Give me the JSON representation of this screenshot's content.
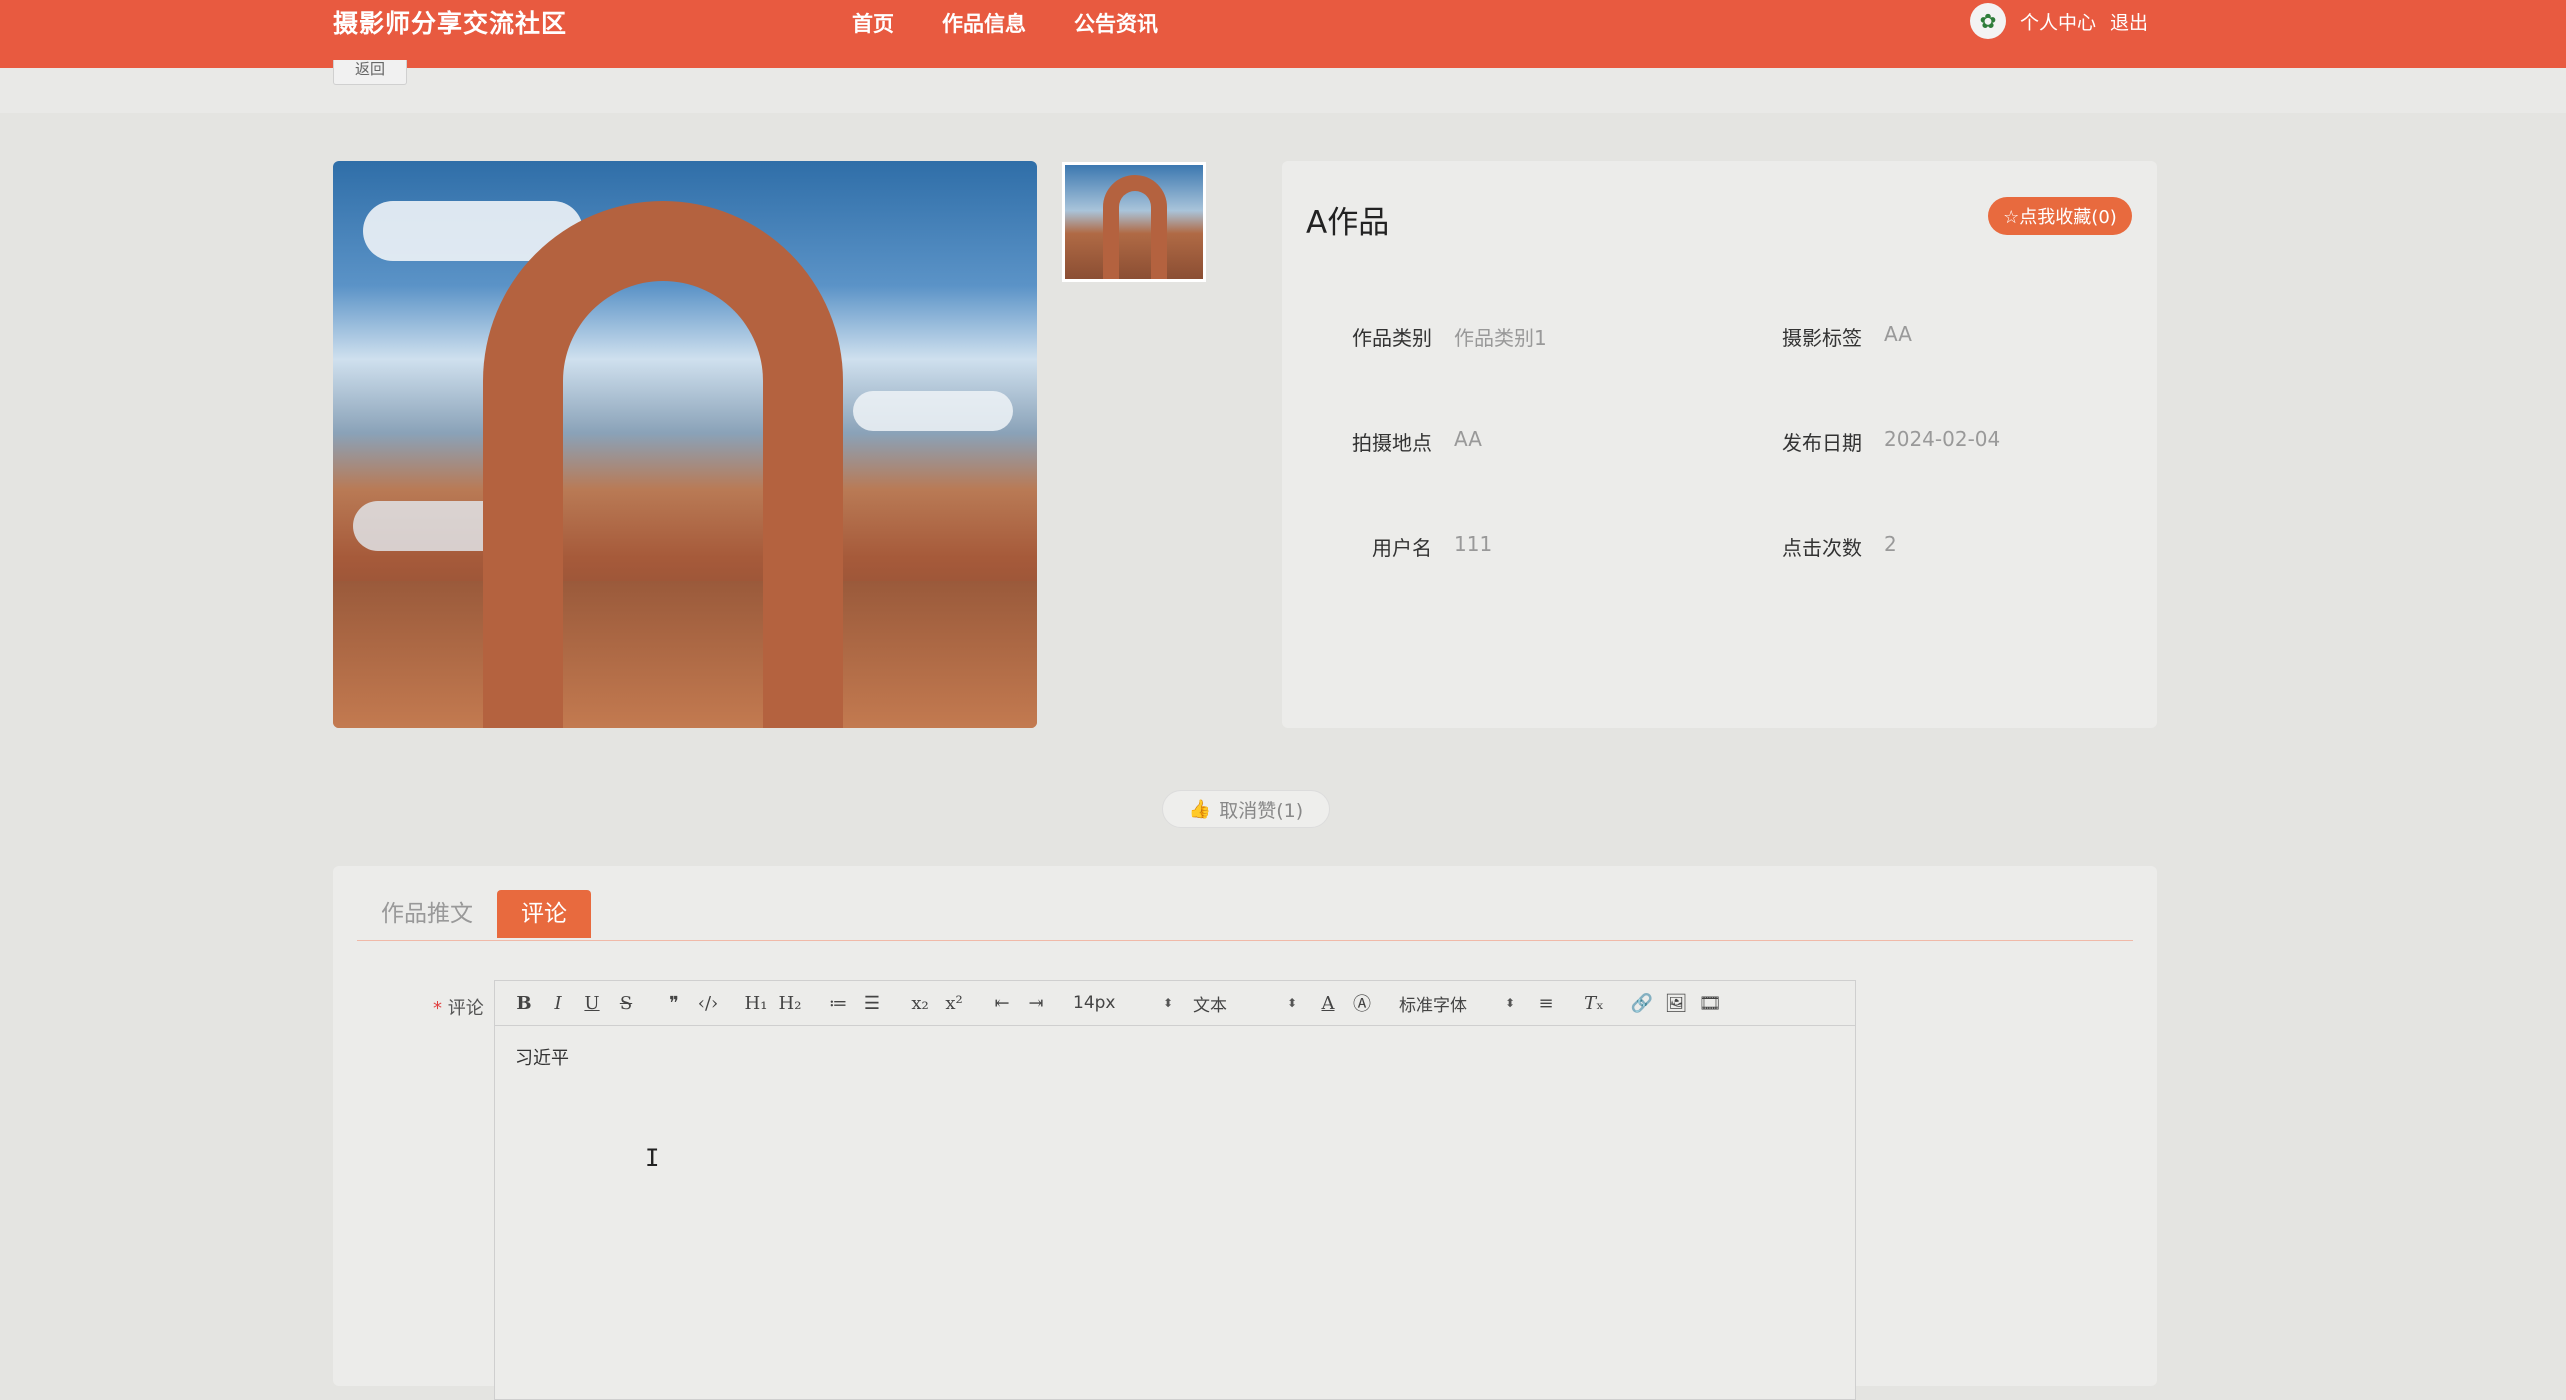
{
  "header": {
    "brand": "摄影师分享交流社区",
    "nav": [
      "首页",
      "作品信息",
      "公告资讯"
    ],
    "user_center": "个人中心",
    "logout": "退出"
  },
  "back_label": "返回",
  "work": {
    "title": "A作品",
    "favorite_label": "☆点我收藏(0)",
    "fields": [
      {
        "label": "作品类别",
        "value": "作品类别1"
      },
      {
        "label": "摄影标签",
        "value": "AA"
      },
      {
        "label": "拍摄地点",
        "value": "AA"
      },
      {
        "label": "发布日期",
        "value": "2024-02-04"
      },
      {
        "label": "用户名",
        "value": "111"
      },
      {
        "label": "点击次数",
        "value": "2"
      }
    ]
  },
  "like_label": "取消赞(1)",
  "tabs": [
    "作品推文",
    "评论"
  ],
  "active_tab": "评论",
  "comment": {
    "label": "评论",
    "required_mark": "*",
    "text": "习近平"
  },
  "toolbar": {
    "font_size": "14px",
    "header_type": "文本",
    "font_family": "标准字体"
  },
  "colors": {
    "header_bg": "#e85a40",
    "accent": "#e86a3e"
  }
}
